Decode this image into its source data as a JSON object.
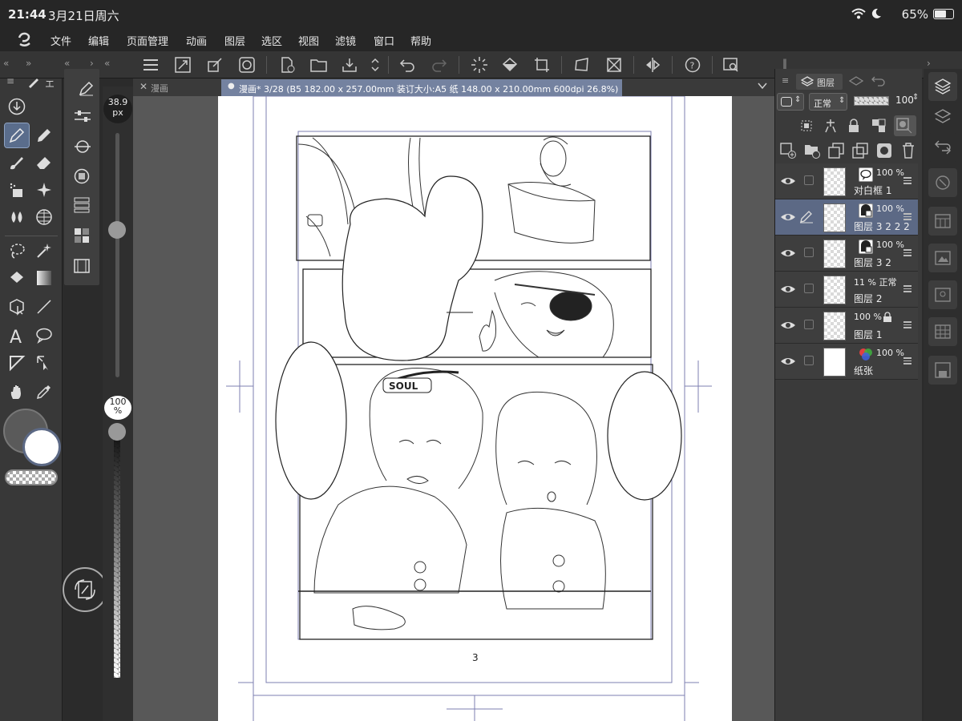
{
  "status": {
    "time": "21:44",
    "date": "3月21日周六",
    "battery": "65%",
    "battery_level": 0.65
  },
  "menu": [
    "文件",
    "编辑",
    "页面管理",
    "动画",
    "图层",
    "选区",
    "视图",
    "滤镜",
    "窗口",
    "帮助"
  ],
  "tool_tab": {
    "label": "エ"
  },
  "brush_size": {
    "value": "38.9",
    "unit": "px"
  },
  "opacity": {
    "value": "100",
    "unit": "%"
  },
  "doc_tabs": [
    {
      "label": "漫画"
    },
    {
      "label": "漫画* 3/28 (B5 182.00 x 257.00mm 装订大小:A5 纸 148.00 x 210.00mm 600dpi 26.8%)"
    }
  ],
  "page_number": "3",
  "speech_bubble_text": "SOUL",
  "layer_panel": {
    "tab": "图层",
    "blend_mode": "正常",
    "opacity": "100"
  },
  "layers": [
    {
      "pct": "100 %",
      "name": "对白框 1",
      "selected": false
    },
    {
      "pct": "100 %",
      "name": "图层 3 2 2 2",
      "selected": true
    },
    {
      "pct": "100 %",
      "name": "图层 3 2",
      "selected": false
    },
    {
      "pct": "11 % 正常",
      "name": "图层 2",
      "selected": false
    },
    {
      "pct": "100 %",
      "name": "图层 1",
      "selected": false
    },
    {
      "pct": "100 %",
      "name": "纸张",
      "selected": false
    }
  ],
  "colors": {
    "main": "#5a5a5a",
    "sub": "#ffffff",
    "selection": "#5c6985"
  }
}
